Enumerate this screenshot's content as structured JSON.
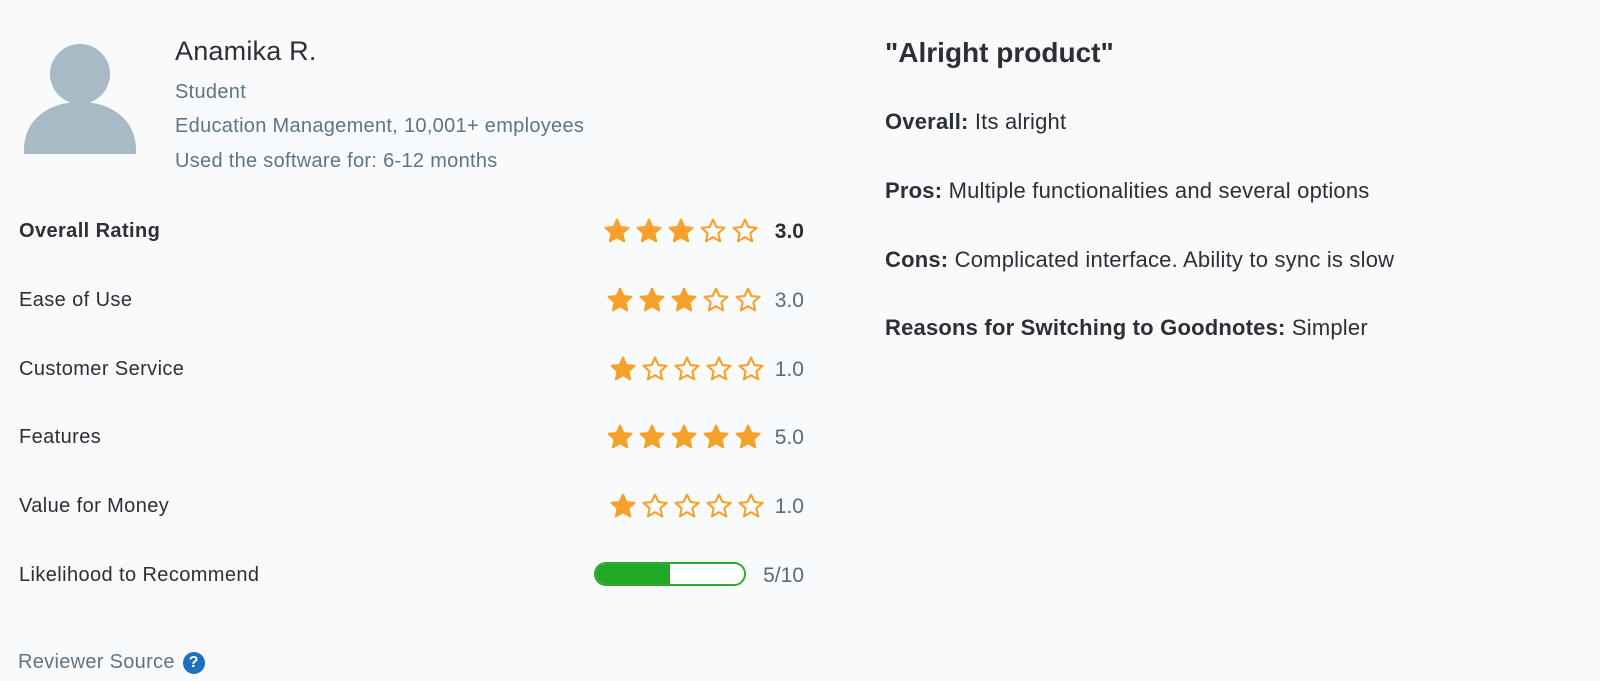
{
  "reviewer": {
    "name": "Anamika R.",
    "role": "Student",
    "industry": "Education Management",
    "company_size": "10,001+ employees",
    "usage_label": "Used the software for:",
    "usage_value": "6-12 months",
    "avatar_icon": "user-silhouette-icon"
  },
  "ratings": [
    {
      "label": "Overall Rating",
      "stars": 3,
      "value": "3.0"
    },
    {
      "label": "Ease of Use",
      "stars": 3,
      "value": "3.0"
    },
    {
      "label": "Customer Service",
      "stars": 1,
      "value": "1.0"
    },
    {
      "label": "Features",
      "stars": 5,
      "value": "5.0"
    },
    {
      "label": "Value for Money",
      "stars": 1,
      "value": "1.0"
    }
  ],
  "recommend": {
    "label": "Likelihood to Recommend",
    "score": 5,
    "max": 10,
    "value_text": "5/10"
  },
  "source": {
    "label": "Reviewer Source",
    "icon": "question-circle-icon"
  },
  "review": {
    "title": "\"Alright product\"",
    "overall_label": "Overall:",
    "overall_text": "Its alright",
    "pros_label": "Pros:",
    "pros_text": "Multiple functionalities and several options",
    "cons_label": "Cons:",
    "cons_text": "Complicated interface. Ability to sync is slow",
    "switch_label": "Reasons for Switching to Goodnotes:",
    "switch_text": "Simpler"
  },
  "colors": {
    "star": "#f7a12b",
    "bar_fill": "#23a726",
    "bar_border": "#2eab2f",
    "avatar": "#a7bac5",
    "meta_text": "#5f7484",
    "help_icon": "#1f6fc5"
  }
}
